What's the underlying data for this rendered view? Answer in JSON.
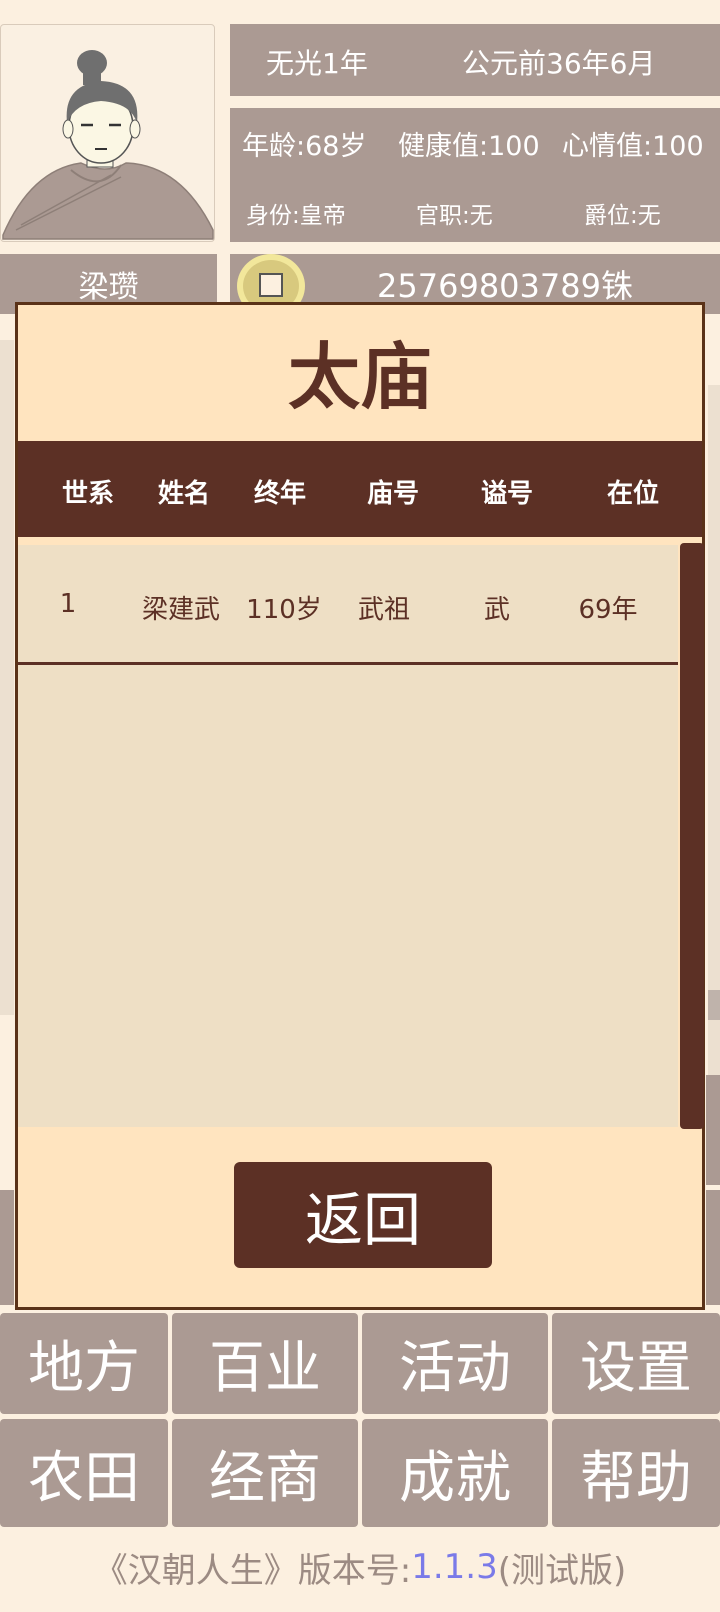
{
  "header": {
    "era": "无光1年",
    "date": "公元前36年6月",
    "age": "年龄:68岁",
    "health": "健康值:100",
    "mood": "心情值:100",
    "identity": "身份:皇帝",
    "office": "官职:无",
    "title": "爵位:无",
    "name": "梁瓒",
    "money": "25769803789铢"
  },
  "modal": {
    "title": "太庙",
    "columns": [
      "世系",
      "姓名",
      "终年",
      "庙号",
      "谥号",
      "在位"
    ],
    "rows": [
      [
        "1",
        "梁建武",
        "110岁",
        "武祖",
        "武",
        "69年"
      ]
    ],
    "back_label": "返回"
  },
  "menu": {
    "row1": [
      "地方",
      "百业",
      "活动",
      "设置"
    ],
    "row2": [
      "农田",
      "经商",
      "成就",
      "帮助"
    ]
  },
  "footer": {
    "prefix": "《汉朝人生》版本号:",
    "version": "1.1.3",
    "suffix": "(测试版)"
  }
}
